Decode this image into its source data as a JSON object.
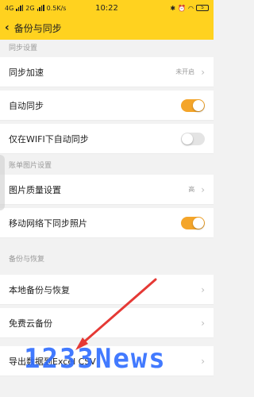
{
  "status_bar": {
    "network_left": "4G",
    "network_right": "2G",
    "speed": "0.5K/s",
    "time": "10:22",
    "battery": "5"
  },
  "header": {
    "title": "备份与同步"
  },
  "sections": {
    "sync": {
      "label": "同步设置",
      "rows": [
        {
          "label": "同步加速",
          "value": "未开启",
          "type": "chevron"
        },
        {
          "label": "自动同步",
          "toggle": "on"
        },
        {
          "label": "仅在WIFI下自动同步",
          "toggle": "off"
        }
      ]
    },
    "images": {
      "label": "账单图片设置",
      "rows": [
        {
          "label": "图片质量设置",
          "value": "高",
          "type": "chevron"
        },
        {
          "label": "移动网络下同步照片",
          "toggle": "on"
        }
      ]
    },
    "backup": {
      "label": "备份与恢复",
      "rows": [
        {
          "label": "本地备份与恢复",
          "type": "chevron"
        },
        {
          "label": "免费云备份",
          "type": "chevron"
        },
        {
          "label": "导出数据到Excel CSV",
          "type": "chevron"
        }
      ]
    }
  },
  "watermark": "1233News",
  "colors": {
    "accent": "#ffd21f",
    "toggle_on": "#f4a52a",
    "arrow": "#e53935"
  }
}
